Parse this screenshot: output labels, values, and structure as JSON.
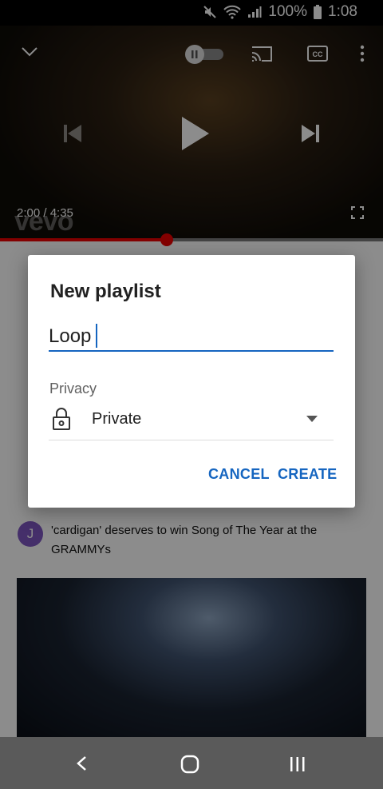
{
  "status_bar": {
    "battery_percent": "100%",
    "time": "1:08",
    "icons": [
      "mute-icon",
      "wifi-icon",
      "signal-icon",
      "battery-icon"
    ]
  },
  "player": {
    "current_time": "2:00",
    "duration": "4:35",
    "time_display": "2:00 / 4:35",
    "watermark": "vevo",
    "progress_fraction": 0.436,
    "icons": [
      "collapse-chevron-icon",
      "autoplay-toggle-icon",
      "cast-icon",
      "captions-icon",
      "more-vert-icon",
      "previous-icon",
      "play-icon",
      "next-icon",
      "fullscreen-icon"
    ]
  },
  "comment_preview": {
    "avatar_letter": "J",
    "text": "'cardigan' deserves to win Song of The Year at the GRAMMYs"
  },
  "dialog": {
    "title": "New playlist",
    "name_value": "Loop",
    "privacy_label": "Privacy",
    "privacy_value": "Private",
    "cancel_label": "CANCEL",
    "create_label": "CREATE"
  },
  "colors": {
    "accent": "#1565c0",
    "progress": "#ee0000",
    "overlay": "rgba(0,0,0,0.45)",
    "nav_bar": "#5a5a5a"
  },
  "nav": [
    "back-icon",
    "home-icon",
    "recents-icon"
  ]
}
